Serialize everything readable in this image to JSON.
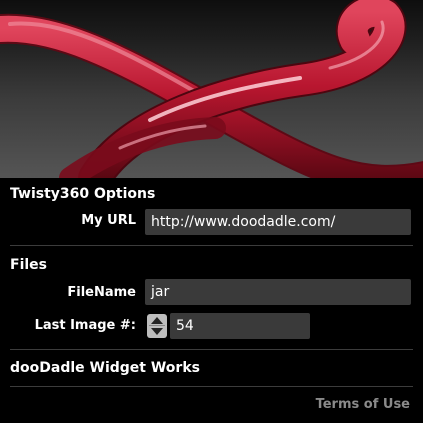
{
  "options_title": "Twisty360 Options",
  "my_url": {
    "label": "My URL",
    "value": "http://www.doodadle.com/"
  },
  "files": {
    "title": "Files",
    "filename": {
      "label": "FileName",
      "value": "jar"
    },
    "last_image": {
      "label": "Last Image #:",
      "value": "54"
    }
  },
  "credit": "dooDadle Widget Works",
  "terms_link": "Terms of Use",
  "colors": {
    "background": "#000000",
    "field": "#3a3a3a",
    "tube": "#c41c36",
    "link": "#8a8a8a"
  },
  "icons": {
    "hero": "twisty-red-tube-image",
    "stepper": "up-down-stepper-icon"
  }
}
